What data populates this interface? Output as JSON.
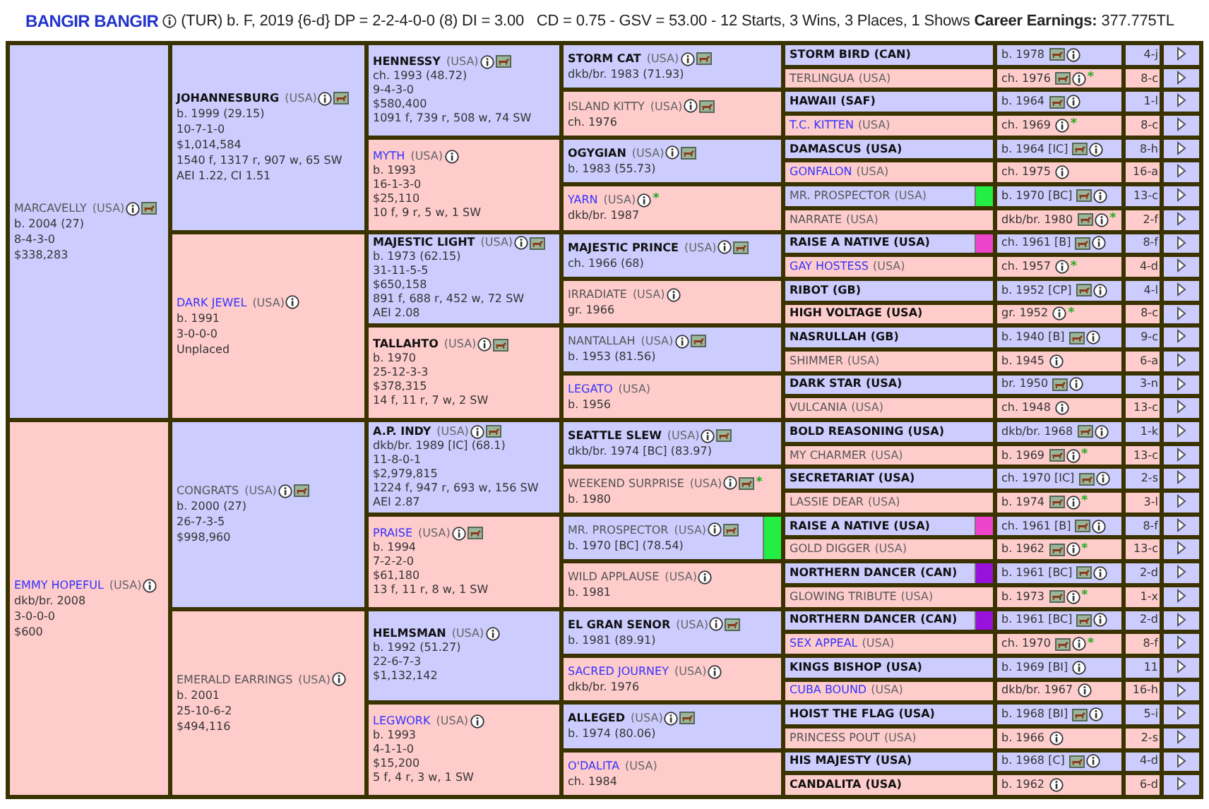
{
  "header": {
    "horse": "BANGIR BANGIR",
    "summary": "(TUR) b. F, 2019 {6-d} DP = 2-2-4-0-0 (8) DI = 3.00   CD = 0.75 - GSV = 53.00 - 12 Starts, 3 Wins, 3 Places, 1 Shows **Career Earnings:** 377.775TL"
  },
  "pedigree": {
    "gen1": [
      {
        "name": "MARCAVELLY",
        "country": "(USA)",
        "kind": "sire",
        "lines": [
          "b. 2004 (27)",
          "8-4-3-0",
          "$338,283"
        ],
        "info": true,
        "photo": true
      },
      {
        "name": "EMMY HOPEFUL",
        "country": "(USA)",
        "kind": "dam",
        "link": true,
        "lines": [
          "dkb/br. 2008",
          "3-0-0-0",
          "$600"
        ],
        "info": true
      }
    ],
    "gen2": [
      {
        "name": "JOHANNESBURG",
        "country": "(USA)",
        "kind": "sire",
        "bold": true,
        "lines": [
          "b. 1999 (29.15)",
          "10-7-1-0",
          "$1,014,584",
          "1540 f, 1317 r, 907 w, 65 SW",
          "AEI 1.22, CI 1.51"
        ],
        "info": true,
        "photo": true
      },
      {
        "name": "DARK JEWEL",
        "country": "(USA)",
        "kind": "dam",
        "link": true,
        "lines": [
          "b. 1991",
          "3-0-0-0",
          "Unplaced"
        ],
        "info": true
      },
      {
        "name": "CONGRATS",
        "country": "(USA)",
        "kind": "sire",
        "lines": [
          "b. 2000 (27)",
          "26-7-3-5",
          "$998,960"
        ],
        "info": true,
        "photo": true
      },
      {
        "name": "EMERALD EARRINGS",
        "country": "(USA)",
        "kind": "dam",
        "lines": [
          "b. 2001",
          "25-10-6-2",
          "$494,116"
        ],
        "info": true
      }
    ],
    "gen3": [
      {
        "name": "HENNESSY",
        "country": "(USA)",
        "kind": "sire",
        "bold": true,
        "lines": [
          "ch. 1993 (48.72)",
          "9-4-3-0",
          "$580,400",
          "1091 f, 739 r, 508 w, 74 SW"
        ],
        "info": true,
        "photo": true
      },
      {
        "name": "MYTH",
        "country": "(USA)",
        "kind": "dam",
        "link": true,
        "lines": [
          "b. 1993",
          "16-1-3-0",
          "$25,110",
          "10 f, 9 r, 5 w, 1 SW"
        ],
        "info": true
      },
      {
        "name": "MAJESTIC LIGHT",
        "country": "(USA)",
        "kind": "sire",
        "bold": true,
        "lines": [
          "b. 1973 (62.15)",
          "31-11-5-5",
          "$650,158",
          "891 f, 688 r, 452 w, 72 SW",
          "AEI 2.08"
        ],
        "info": true,
        "photo": true
      },
      {
        "name": "TALLAHTO",
        "country": "(USA)",
        "kind": "dam",
        "bold": true,
        "lines": [
          "b. 1970",
          "25-12-3-3",
          "$378,315",
          "14 f, 11 r, 7 w, 2 SW"
        ],
        "info": true,
        "photo": true
      },
      {
        "name": "A.P. INDY",
        "country": "(USA)",
        "kind": "sire",
        "bold": true,
        "lines": [
          "dkb/br. 1989 [IC] (68.1)",
          "11-8-0-1",
          "$2,979,815",
          "1224 f, 947 r, 693 w, 156 SW",
          "AEI 2.87"
        ],
        "info": true,
        "photo": true
      },
      {
        "name": "PRAISE",
        "country": "(USA)",
        "kind": "dam",
        "link": true,
        "lines": [
          "b. 1994",
          "7-2-2-0",
          "$61,180",
          "13 f, 11 r, 8 w, 1 SW"
        ],
        "info": true,
        "photo": true
      },
      {
        "name": "HELMSMAN",
        "country": "(USA)",
        "kind": "sire",
        "bold": true,
        "lines": [
          "b. 1992 (51.27)",
          "22-6-7-3",
          "$1,132,142"
        ],
        "info": true
      },
      {
        "name": "LEGWORK",
        "country": "(USA)",
        "kind": "dam",
        "link": true,
        "lines": [
          "b. 1993",
          "4-1-1-0",
          "$15,200",
          "5 f, 4 r, 3 w, 1 SW"
        ],
        "info": true
      }
    ],
    "gen4": [
      {
        "name": "STORM CAT",
        "country": "(USA)",
        "kind": "sire",
        "bold": true,
        "lines": [
          "dkb/br. 1983 (71.93)"
        ],
        "info": true,
        "photo": true
      },
      {
        "name": "ISLAND KITTY",
        "country": "(USA)",
        "kind": "dam",
        "lines": [
          "ch. 1976"
        ],
        "info": true,
        "photo": true
      },
      {
        "name": "OGYGIAN",
        "country": "(USA)",
        "kind": "sire",
        "bold": true,
        "lines": [
          "b. 1983 (55.73)"
        ],
        "info": true,
        "photo": true
      },
      {
        "name": "YARN",
        "country": "(USA)",
        "kind": "dam",
        "link": true,
        "lines": [
          "dkb/br. 1987"
        ],
        "info": true,
        "note": "*"
      },
      {
        "name": "MAJESTIC PRINCE",
        "country": "(USA)",
        "kind": "sire",
        "bold": true,
        "lines": [
          "ch. 1966 (68)"
        ],
        "info": true,
        "photo": true
      },
      {
        "name": "IRRADIATE",
        "country": "(USA)",
        "kind": "dam",
        "lines": [
          "gr. 1966"
        ],
        "info": true
      },
      {
        "name": "NANTALLAH",
        "country": "(USA)",
        "kind": "sire",
        "lines": [
          "b. 1953 (81.56)"
        ],
        "info": true,
        "photo": true
      },
      {
        "name": "LEGATO",
        "country": "(USA)",
        "kind": "dam",
        "link": true,
        "lines": [
          "b. 1956"
        ]
      },
      {
        "name": "SEATTLE SLEW",
        "country": "(USA)",
        "kind": "sire",
        "bold": true,
        "lines": [
          "dkb/br. 1974 [BC] (83.97)"
        ],
        "info": true,
        "photo": true
      },
      {
        "name": "WEEKEND SURPRISE",
        "country": "(USA)",
        "kind": "dam",
        "lines": [
          "b. 1980"
        ],
        "info": true,
        "photo": true,
        "note": "*"
      },
      {
        "name": "MR. PROSPECTOR",
        "country": "(USA)",
        "kind": "sire",
        "lines": [
          "b. 1970 [BC] (78.54)"
        ],
        "info": true,
        "photo": true,
        "color": "#22ee44"
      },
      {
        "name": "WILD APPLAUSE",
        "country": "(USA)",
        "kind": "dam",
        "lines": [
          "b. 1981"
        ],
        "info": true
      },
      {
        "name": "EL GRAN SENOR",
        "country": "(USA)",
        "kind": "sire",
        "bold": true,
        "lines": [
          "b. 1981 (89.91)"
        ],
        "info": true,
        "photo": true
      },
      {
        "name": "SACRED JOURNEY",
        "country": "(USA)",
        "kind": "dam",
        "link": true,
        "lines": [
          "dkb/br. 1976"
        ],
        "info": true
      },
      {
        "name": "ALLEGED",
        "country": "(USA)",
        "kind": "sire",
        "bold": true,
        "lines": [
          "b. 1974 (80.06)"
        ],
        "info": true,
        "photo": true
      },
      {
        "name": "O'DALITA",
        "country": "(USA)",
        "kind": "dam",
        "link": true,
        "lines": [
          "ch. 1984"
        ]
      }
    ],
    "gen5": [
      {
        "name": "STORM BIRD",
        "country": "(CAN)",
        "kind": "sire",
        "bold": true,
        "year": "b. 1978",
        "code": "4-j",
        "info": true,
        "photo": true
      },
      {
        "name": "TERLINGUA",
        "country": "(USA)",
        "kind": "dam",
        "year": "ch. 1976",
        "code": "8-c",
        "info": true,
        "photo": true,
        "note": "*"
      },
      {
        "name": "HAWAII",
        "country": "(SAF)",
        "kind": "sire",
        "bold": true,
        "year": "b. 1964",
        "code": "1-l",
        "info": true,
        "photo": true
      },
      {
        "name": "T.C. KITTEN",
        "country": "(USA)",
        "kind": "dam",
        "link": true,
        "year": "ch. 1969",
        "code": "8-c",
        "info": true,
        "note": "*"
      },
      {
        "name": "DAMASCUS",
        "country": "(USA)",
        "kind": "sire",
        "bold": true,
        "year": "b. 1964 [IC]",
        "code": "8-h",
        "info": true,
        "photo": true
      },
      {
        "name": "GONFALON",
        "country": "(USA)",
        "kind": "dam",
        "link": true,
        "year": "ch. 1975",
        "code": "16-a",
        "info": true
      },
      {
        "name": "MR. PROSPECTOR",
        "country": "(USA)",
        "kind": "sire",
        "year": "b. 1970 [BC]",
        "code": "13-c",
        "info": true,
        "photo": true,
        "color": "#22ee44"
      },
      {
        "name": "NARRATE",
        "country": "(USA)",
        "kind": "dam",
        "year": "dkb/br. 1980",
        "code": "2-f",
        "info": true,
        "photo": true,
        "note": "*"
      },
      {
        "name": "RAISE A NATIVE",
        "country": "(USA)",
        "kind": "sire",
        "bold": true,
        "year": "ch. 1961 [B]",
        "code": "8-f",
        "info": true,
        "photo": true,
        "color": "#ee44cc"
      },
      {
        "name": "GAY HOSTESS",
        "country": "(USA)",
        "kind": "dam",
        "link": true,
        "year": "ch. 1957",
        "code": "4-d",
        "info": true,
        "note": "*"
      },
      {
        "name": "RIBOT",
        "country": "(GB)",
        "kind": "sire",
        "bold": true,
        "year": "b. 1952 [CP]",
        "code": "4-l",
        "info": true,
        "photo": true
      },
      {
        "name": "HIGH VOLTAGE",
        "country": "(USA)",
        "kind": "dam",
        "bold": true,
        "year": "gr. 1952",
        "code": "8-c",
        "info": true,
        "note": "*"
      },
      {
        "name": "NASRULLAH",
        "country": "(GB)",
        "kind": "sire",
        "bold": true,
        "year": "b. 1940 [B]",
        "code": "9-c",
        "info": true,
        "photo": true
      },
      {
        "name": "SHIMMER",
        "country": "(USA)",
        "kind": "dam",
        "year": "b. 1945",
        "code": "6-a",
        "info": true
      },
      {
        "name": "DARK STAR",
        "country": "(USA)",
        "kind": "sire",
        "bold": true,
        "year": "br. 1950",
        "code": "3-n",
        "info": true,
        "photo": true
      },
      {
        "name": "VULCANIA",
        "country": "(USA)",
        "kind": "dam",
        "year": "ch. 1948",
        "code": "13-c",
        "info": true
      },
      {
        "name": "BOLD REASONING",
        "country": "(USA)",
        "kind": "sire",
        "bold": true,
        "year": "dkb/br. 1968",
        "code": "1-k",
        "info": true,
        "photo": true
      },
      {
        "name": "MY CHARMER",
        "country": "(USA)",
        "kind": "dam",
        "year": "b. 1969",
        "code": "13-c",
        "info": true,
        "photo": true,
        "note": "*"
      },
      {
        "name": "SECRETARIAT",
        "country": "(USA)",
        "kind": "sire",
        "bold": true,
        "year": "ch. 1970 [IC]",
        "code": "2-s",
        "info": true,
        "photo": true
      },
      {
        "name": "LASSIE DEAR",
        "country": "(USA)",
        "kind": "dam",
        "year": "b. 1974",
        "code": "3-l",
        "info": true,
        "photo": true,
        "note": "*"
      },
      {
        "name": "RAISE A NATIVE",
        "country": "(USA)",
        "kind": "sire",
        "bold": true,
        "year": "ch. 1961 [B]",
        "code": "8-f",
        "info": true,
        "photo": true,
        "color": "#ee44cc"
      },
      {
        "name": "GOLD DIGGER",
        "country": "(USA)",
        "kind": "dam",
        "year": "b. 1962",
        "code": "13-c",
        "info": true,
        "photo": true,
        "note": "*"
      },
      {
        "name": "NORTHERN DANCER",
        "country": "(CAN)",
        "kind": "sire",
        "bold": true,
        "year": "b. 1961 [BC]",
        "code": "2-d",
        "info": true,
        "photo": true,
        "color": "#9911dd"
      },
      {
        "name": "GLOWING TRIBUTE",
        "country": "(USA)",
        "kind": "dam",
        "year": "b. 1973",
        "code": "1-x",
        "info": true,
        "photo": true,
        "note": "*"
      },
      {
        "name": "NORTHERN DANCER",
        "country": "(CAN)",
        "kind": "sire",
        "bold": true,
        "year": "b. 1961 [BC]",
        "code": "2-d",
        "info": true,
        "photo": true,
        "color": "#9911dd"
      },
      {
        "name": "SEX APPEAL",
        "country": "(USA)",
        "kind": "dam",
        "link": true,
        "year": "ch. 1970",
        "code": "8-f",
        "info": true,
        "photo": true,
        "note": "*"
      },
      {
        "name": "KINGS BISHOP",
        "country": "(USA)",
        "kind": "sire",
        "bold": true,
        "year": "b. 1969 [BI]",
        "code": "11",
        "info": true
      },
      {
        "name": "CUBA BOUND",
        "country": "(USA)",
        "kind": "dam",
        "link": true,
        "year": "dkb/br. 1967",
        "code": "16-h",
        "info": true
      },
      {
        "name": "HOIST THE FLAG",
        "country": "(USA)",
        "kind": "sire",
        "bold": true,
        "year": "b. 1968 [BI]",
        "code": "5-i",
        "info": true,
        "photo": true
      },
      {
        "name": "PRINCESS POUT",
        "country": "(USA)",
        "kind": "dam",
        "year": "b. 1966",
        "code": "2-s",
        "info": true
      },
      {
        "name": "HIS MAJESTY",
        "country": "(USA)",
        "kind": "sire",
        "bold": true,
        "year": "b. 1968 [C]",
        "code": "4-d",
        "info": true,
        "photo": true
      },
      {
        "name": "CANDALITA",
        "country": "(USA)",
        "kind": "dam",
        "bold": true,
        "year": "b. 1962",
        "code": "6-d",
        "info": true
      }
    ]
  }
}
